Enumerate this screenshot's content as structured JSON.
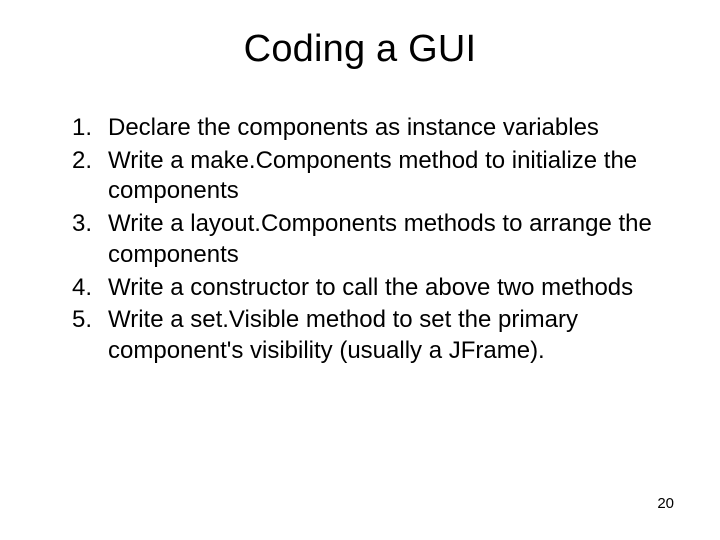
{
  "title": "Coding a GUI",
  "items": [
    {
      "num": "1.",
      "text": "Declare the components as instance variables"
    },
    {
      "num": "2.",
      "text": "Write a make.Components method to initialize the components"
    },
    {
      "num": "3.",
      "text": "Write a layout.Components methods to arrange the components"
    },
    {
      "num": "4.",
      "text": "Write a constructor to call the above two methods"
    },
    {
      "num": "5.",
      "text": "Write a set.Visible method to set the primary component's visibility (usually a JFrame)."
    }
  ],
  "page_number": "20"
}
